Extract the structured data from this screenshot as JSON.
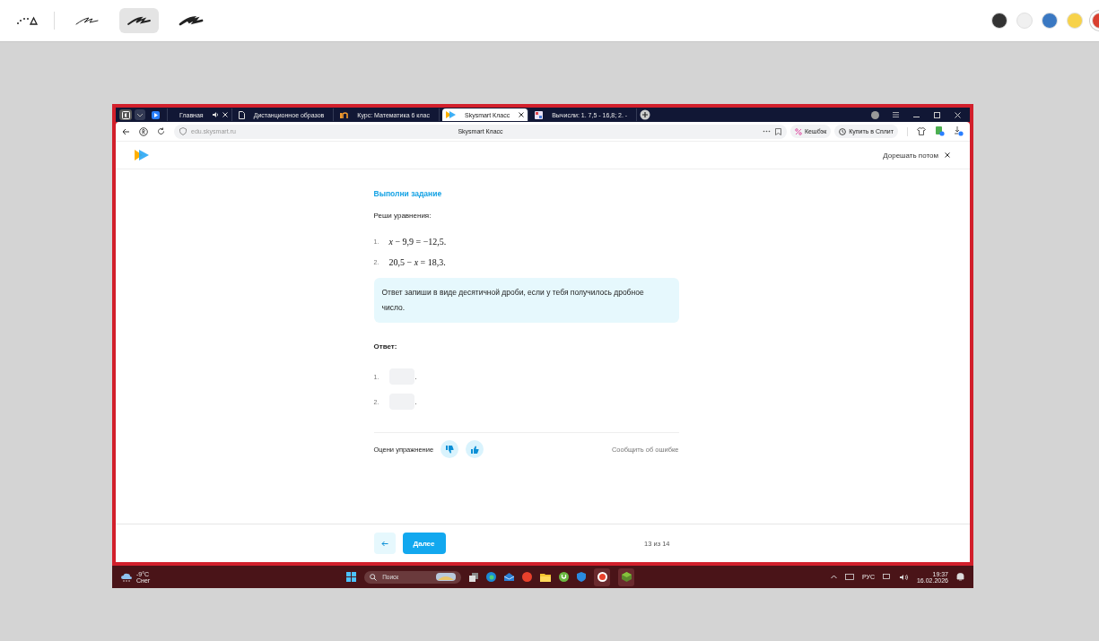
{
  "toolbar": {
    "tools": [
      {
        "kind": "lasso",
        "selected": false
      },
      {
        "kind": "pen-thin",
        "selected": false
      },
      {
        "kind": "pen-medium",
        "selected": true
      },
      {
        "kind": "pen-thick",
        "selected": false
      }
    ],
    "colors": [
      {
        "color": "#333333",
        "selected": false
      },
      {
        "color": "#f0f0f0",
        "selected": false
      },
      {
        "color": "#3a78c2",
        "selected": false
      },
      {
        "color": "#f7d24a",
        "selected": false
      },
      {
        "color": "#d94030",
        "selected": true
      }
    ]
  },
  "browser": {
    "tabs": [
      {
        "kind": "play",
        "selected": false
      },
      {
        "kind": "audio",
        "label": "Главная",
        "selected": false
      },
      {
        "kind": "doc",
        "label": "Дистанционное образов",
        "selected": false
      },
      {
        "kind": "course",
        "label": "Курс: Математика 6 клас",
        "selected": false
      },
      {
        "kind": "skysmart",
        "label": "Skysmart Класс",
        "selected": true
      },
      {
        "kind": "image",
        "label": "Вычисли: 1. 7,5 - 16,8; 2. -",
        "selected": false
      }
    ],
    "address": "edu.skysmart.ru",
    "page_title": "Skysmart Класс",
    "cashback": "Кешбэк",
    "split": "Купить в Сплит"
  },
  "page": {
    "later": "Дорешать потом",
    "heading": "Выполни задание",
    "prompt": "Реши уравнения:",
    "equations": [
      {
        "number": "1.",
        "text": "*x* − 9,9 = −12,5."
      },
      {
        "number": "2.",
        "text": "20,5 − *x* = 18,3."
      }
    ],
    "hint": "Ответ запиши в виде десятичной дроби, если у тебя получилось дробное число.",
    "answer_label": "Ответ:",
    "answers": [
      {
        "number": "1.",
        "suffix": "."
      },
      {
        "number": "2.",
        "suffix": "."
      }
    ],
    "rate_label": "Оцени упражнение",
    "report": "Сообщить об ошибке",
    "next": "Далее",
    "progress": "13 из 14"
  },
  "taskbar": {
    "temp": "-9°C",
    "weather": "Снег",
    "search": "Поиск",
    "lang": "РУС",
    "time": "19:37",
    "date": "16.02.2026"
  }
}
